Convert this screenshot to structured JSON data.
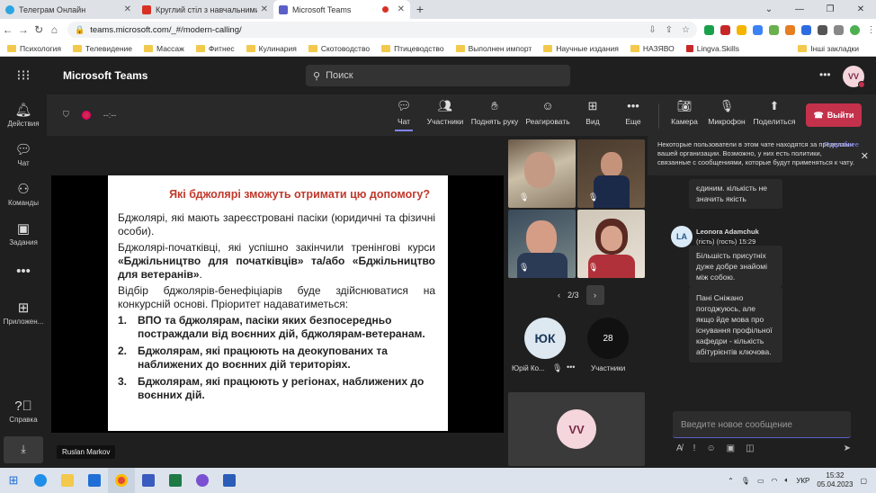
{
  "browser": {
    "tabs": [
      {
        "label": "Телеграм Онлайн",
        "color": "#2ca5e0",
        "active": false
      },
      {
        "label": "Круглий стіл з навчальними зак",
        "color": "#d93025",
        "active": false
      },
      {
        "label": "Microsoft Teams",
        "color": "#5b5fc7",
        "active": true
      }
    ],
    "new_tab": "+",
    "url": "teams.microsoft.com/_#/modern-calling/",
    "bookmarks": [
      "Психология",
      "Телевидение",
      "Массаж",
      "Фитнес",
      "Кулинария",
      "Скотоводство",
      "Птицеводство",
      "Выполнен импорт",
      "Научные издания",
      "НАЗЯВО",
      "Lingva.Skills"
    ],
    "bookmarks_right": "Інші закладки"
  },
  "teams": {
    "app_title": "Microsoft Teams",
    "search_placeholder": "Поиск",
    "avatar_initials": "VV",
    "rail": [
      {
        "label": "Действия",
        "icon": "bell-icon"
      },
      {
        "label": "Чат",
        "icon": "chat-icon"
      },
      {
        "label": "Команды",
        "icon": "teams-icon"
      },
      {
        "label": "Задания",
        "icon": "assignments-icon"
      },
      {
        "label": "",
        "icon": "more-icon"
      },
      {
        "label": "Приложен...",
        "icon": "apps-icon"
      },
      {
        "label": "Справка",
        "icon": "help-icon"
      }
    ],
    "timer": "--:--",
    "toolbar": {
      "chat": "Чат",
      "participants": "Участники",
      "raise_hand": "Поднять руку",
      "react": "Реагировать",
      "view": "Вид",
      "more": "Еще",
      "camera": "Камера",
      "mic": "Микрофон",
      "share": "Поделиться",
      "leave": "Выйти"
    },
    "presenter_name": "Ruslan Markov"
  },
  "slide": {
    "title": "Які бджолярі зможуть отримати цю допомогу?",
    "para1": "Бджолярі, які мають зареєстровані пасіки (юридичні та фізичні особи).",
    "para2_prefix": "Бджолярі-початківці, які успішно закінчили тренінгові курси ",
    "para2_bold": "«Бджільництво для початківців» та/або «Бджільництво для ветеранів»",
    "para2_suffix": ".",
    "para3": "Відбір бджолярів-бенефіціарів буде здійснюватися на конкурсній основі. Пріоритет надаватиметься:",
    "items": [
      {
        "num": "1.",
        "text": "ВПО та бджолярам, пасіки яких безпосередньо постраждали від воєнних дій, бджолярам-ветеранам."
      },
      {
        "num": "2.",
        "text": "Бджолярам, які працюють на деокупованих та наближених до воєнних дій територіях."
      },
      {
        "num": "3.",
        "text": "Бджолярам, які працюють у регіонах, наближених до воєнних дій."
      }
    ]
  },
  "participants": {
    "pager": "2/3",
    "yk_initials": "ЮК",
    "yk_name": "Юрій Ко...",
    "count": "28",
    "count_label": "Участники",
    "self_initials": "VV"
  },
  "chat": {
    "notice": "Некоторые пользователи в этом чате находятся за пределами вашей организации. Возможно, у них есть политики, связанные с сообщениями, которые будут применяться к чату.",
    "notice_more": "Подробнее",
    "msg0": "єдиним. кількість не значить якість",
    "sender_initials": "LA",
    "sender_name": "Leonora Adamchuk",
    "sender_meta": "(гість) (гость)   15:29",
    "msg1": "Більшість присутніх дуже добре знайомі між собою.",
    "msg2": "Пані Сніжано погоджуюсь, але якщо йде мова про існування профільної кафедри - кількість абітурієнтів ключова.",
    "compose_placeholder": "Введите новое сообщение"
  },
  "taskbar": {
    "lang": "УКР",
    "time": "15:32",
    "date": "05.04.2023"
  }
}
